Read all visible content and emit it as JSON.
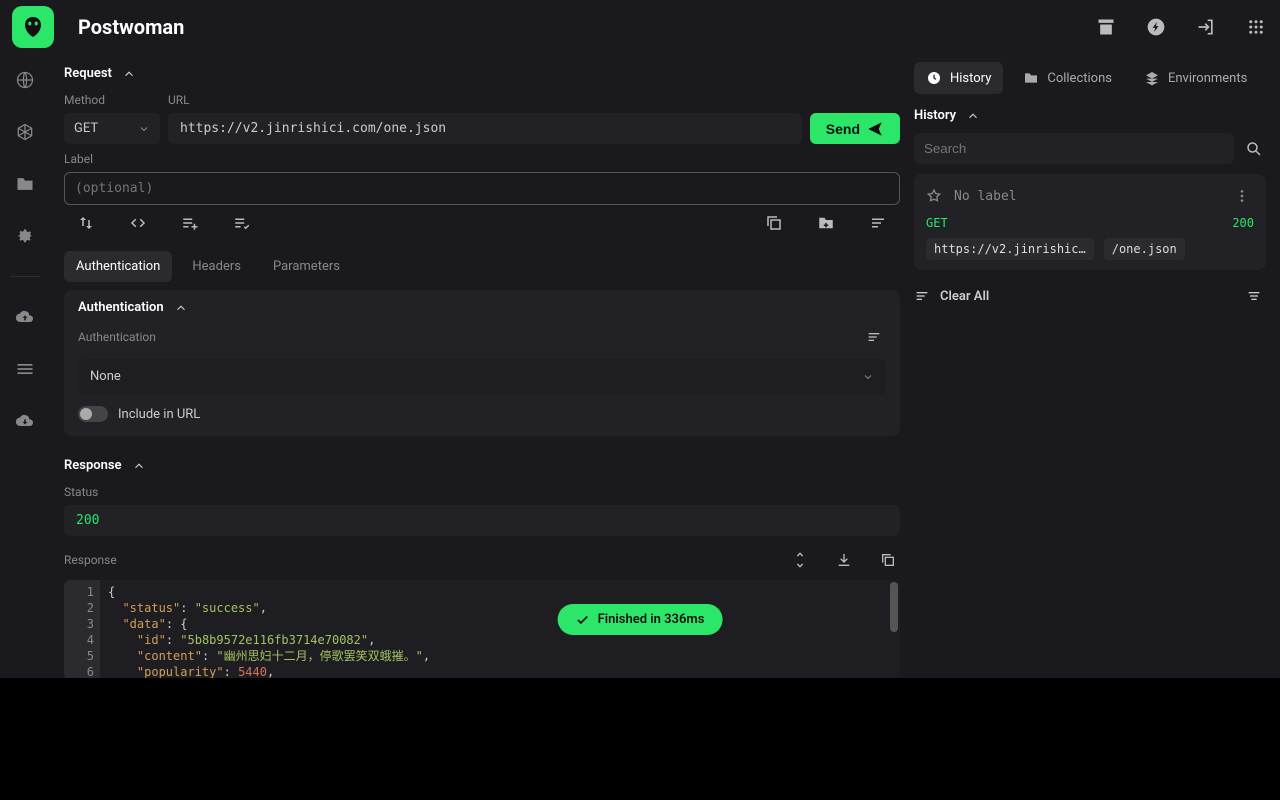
{
  "app": {
    "title": "Postwoman"
  },
  "request": {
    "section_label": "Request",
    "method_label": "Method",
    "url_label": "URL",
    "label_label": "Label",
    "label_placeholder": "(optional)",
    "method": "GET",
    "url": "https://v2.jinrishici.com/one.json",
    "send_label": "Send"
  },
  "tabs": {
    "auth": "Authentication",
    "headers": "Headers",
    "params": "Parameters"
  },
  "auth": {
    "section_label": "Authentication",
    "field_label": "Authentication",
    "value": "None",
    "toggle_label": "Include in URL"
  },
  "response": {
    "section_label": "Response",
    "status_label": "Status",
    "status": "200",
    "body_label": "Response",
    "lines": [
      "1",
      "2",
      "3",
      "4",
      "5",
      "6"
    ],
    "code": {
      "l2k": "\"status\"",
      "l2v": "\"success\"",
      "l3k": "\"data\"",
      "l4k": "\"id\"",
      "l4v": "\"5b8b9572e116fb3714e70082\"",
      "l5k": "\"content\"",
      "l5v": "\"幽州思妇十二月，停歌罢笑双蛾摧。\"",
      "l6k": "\"popularity\"",
      "l6v": "5440"
    }
  },
  "toast": {
    "text": "Finished in 336ms"
  },
  "right": {
    "tabs": {
      "history": "History",
      "collections": "Collections",
      "envs": "Environments"
    },
    "history_label": "History",
    "search_placeholder": "Search",
    "nolabel": "No label",
    "item": {
      "method": "GET",
      "status": "200",
      "host": "https://v2.jinrishic…",
      "path": "/one.json"
    },
    "clear_all": "Clear All"
  }
}
